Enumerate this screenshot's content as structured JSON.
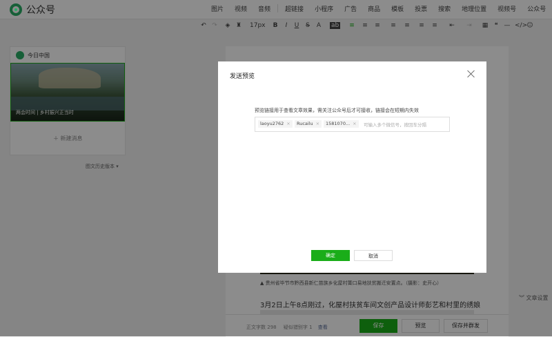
{
  "header": {
    "app_name": "公众号",
    "insert_items_left": [
      "图片",
      "视频",
      "音频"
    ],
    "insert_items_right": [
      "超链接",
      "小程序",
      "广告",
      "商品",
      "模板",
      "投票",
      "搜索",
      "地理位置",
      "视频号",
      "公众号"
    ],
    "more": "···"
  },
  "toolbar": {
    "font_size": "17px",
    "items": [
      "↶",
      "↷",
      "◈",
      "♜",
      "B",
      "I",
      "U",
      "S",
      "A",
      "ab",
      "≡",
      "≡",
      "≡",
      "≡",
      "≡",
      "≡",
      "≡",
      "⇤",
      "⇥",
      "▦",
      "❝",
      "—",
      "</>",
      "☺"
    ]
  },
  "sidebar": {
    "account_name": "今日中国",
    "cover_title": "两会时间 | 乡村振兴正当时",
    "new_message": "新建消息",
    "history": "图文历史版本"
  },
  "article": {
    "caption": "▲ 贵州省毕节市黔西县新仁苗族乡化屋村箐口易地扶贫搬迁安置点。（摄影：史开心）",
    "paragraph": "3月2日上午8点刚过，化屋村扶贫车间文创产品设计师彭艺和村里的绣娘们开"
  },
  "side_settings": "文章设置",
  "bottom": {
    "word_count_label": "正文字数",
    "word_count": "298",
    "typo_label": "疑似错别字",
    "typo_count": "1",
    "view": "查看",
    "save": "保存",
    "preview": "预览",
    "publish": "保存并群发"
  },
  "dialog": {
    "title": "发送预览",
    "hint": "预览链接用于查看文章效果，需关注公众号后才可接收，链接会在短期内失效",
    "tags": [
      "laoyu2762",
      "Rucailu",
      "1581070..."
    ],
    "placeholder": "可输入多个微信号，按回车分隔",
    "confirm": "确定",
    "cancel": "取消"
  },
  "colors": {
    "accent": "#1aad19",
    "overlay": "rgba(0,0,0,0.45)"
  }
}
